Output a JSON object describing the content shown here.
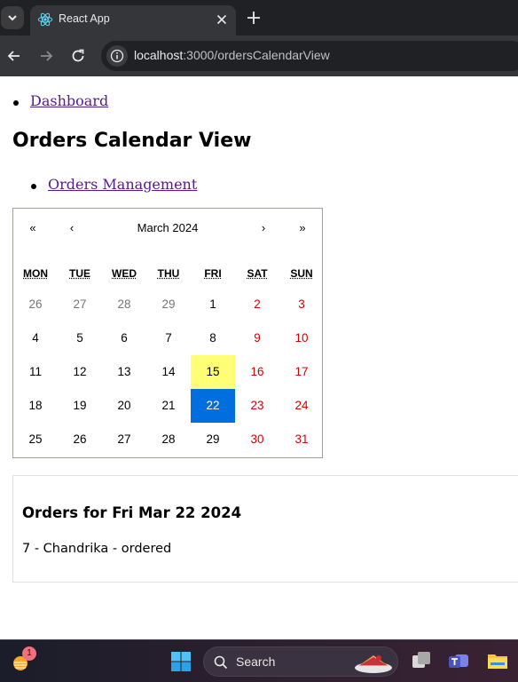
{
  "browser": {
    "tab_title": "React App",
    "url_host": "localhost",
    "url_path": ":3000/ordersCalendarView"
  },
  "nav": {
    "dashboard_link": "Dashboard"
  },
  "page_title": "Orders Calendar View",
  "sub_nav": {
    "orders_management_link": "Orders Management"
  },
  "calendar": {
    "prev2_label": "«",
    "prev_label": "‹",
    "month_label": "March 2024",
    "next_label": "›",
    "next2_label": "»",
    "weekdays": [
      "MON",
      "TUE",
      "WED",
      "THU",
      "FRI",
      "SAT",
      "SUN"
    ],
    "weeks": [
      [
        "26",
        "27",
        "28",
        "29",
        "1",
        "2",
        "3"
      ],
      [
        "4",
        "5",
        "6",
        "7",
        "8",
        "9",
        "10"
      ],
      [
        "11",
        "12",
        "13",
        "14",
        "15",
        "16",
        "17"
      ],
      [
        "18",
        "19",
        "20",
        "21",
        "22",
        "23",
        "24"
      ],
      [
        "25",
        "26",
        "27",
        "28",
        "29",
        "30",
        "31"
      ]
    ],
    "today_day": "15",
    "selected_day": "22",
    "colors": {
      "today_bg": "#ffff76",
      "selected_bg": "#006edc",
      "weekend": "#d10000",
      "neighbor": "#757575"
    }
  },
  "orders": {
    "heading": "Orders for Fri Mar 22 2024",
    "items": [
      "7 - Chandrika - ordered"
    ]
  },
  "taskbar": {
    "widget_badge": "1",
    "search_label": "Search"
  }
}
